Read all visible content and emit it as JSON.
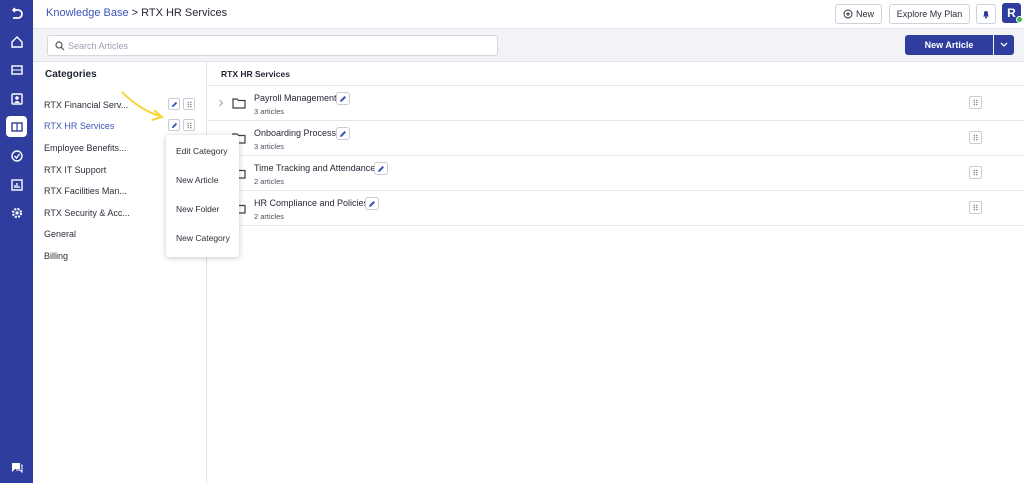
{
  "theme": {
    "primary": "#2f3e9e",
    "link": "#3d55b8",
    "annotation_arrow": "#f5d63b",
    "status_online": "#3bb54a"
  },
  "rail": {
    "icons": [
      "logo-icon",
      "home-icon",
      "ticket-icon",
      "contacts-icon",
      "knowledge-base-icon",
      "tasks-icon",
      "reports-icon",
      "settings-icon",
      "chat-icon"
    ],
    "active": "knowledge-base-icon"
  },
  "header": {
    "breadcrumb": {
      "root": "Knowledge Base",
      "separator": ">",
      "current": "RTX HR Services"
    },
    "new_label": "New",
    "explore_label": "Explore My Plan",
    "avatar_letter": "R"
  },
  "search": {
    "placeholder": "Search Articles",
    "value": ""
  },
  "new_article_label": "New Article",
  "categories": {
    "title": "Categories",
    "items": [
      {
        "label": "RTX Financial Serv..."
      },
      {
        "label": "RTX HR Services",
        "active": true
      },
      {
        "label": "Employee Benefits..."
      },
      {
        "label": "RTX IT Support"
      },
      {
        "label": "RTX Facilities Man..."
      },
      {
        "label": "RTX Security & Acc..."
      },
      {
        "label": "General"
      },
      {
        "label": "Billing"
      }
    ]
  },
  "context_menu": {
    "items": [
      "Edit Category",
      "New Article",
      "New Folder",
      "New Category"
    ]
  },
  "content": {
    "title": "RTX HR Services",
    "folders": [
      {
        "name": "Payroll Management",
        "count": "3 articles"
      },
      {
        "name": "Onboarding Process",
        "count": "3 articles"
      },
      {
        "name": "Time Tracking and Attendance",
        "count": "2 articles"
      },
      {
        "name": "HR Compliance and Policies",
        "count": "2 articles"
      }
    ]
  }
}
